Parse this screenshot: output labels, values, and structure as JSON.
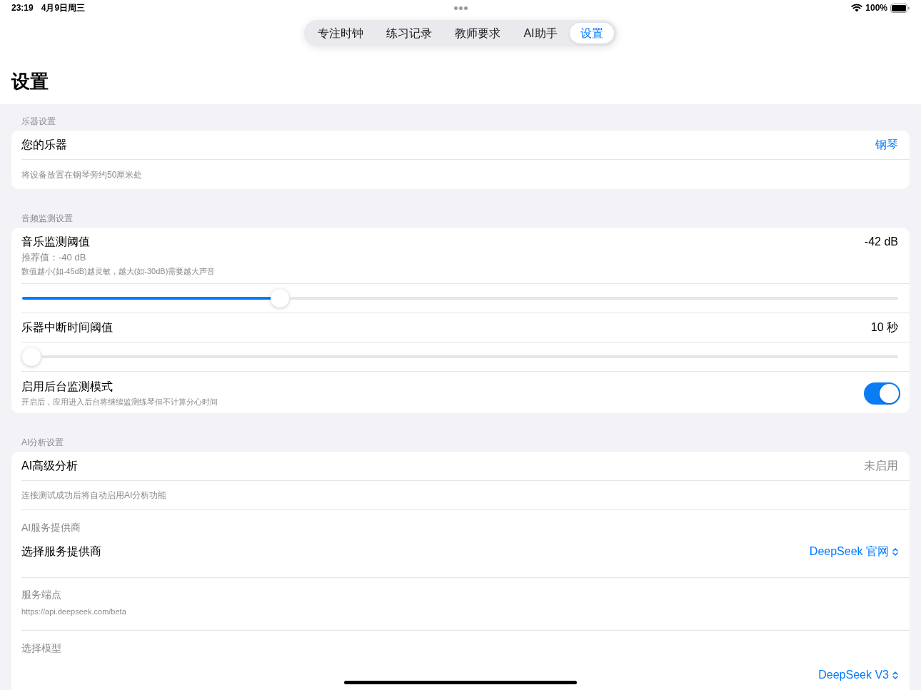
{
  "status_bar": {
    "time": "23:19",
    "date": "4月9日周三",
    "battery": "100%"
  },
  "tabs": [
    {
      "label": "专注时钟",
      "selected": false
    },
    {
      "label": "练习记录",
      "selected": false
    },
    {
      "label": "教师要求",
      "selected": false
    },
    {
      "label": "AI助手",
      "selected": false
    },
    {
      "label": "设置",
      "selected": true
    }
  ],
  "page_title": "设置",
  "sections": [
    {
      "header": "乐器设置",
      "rows": [
        {
          "kind": "value",
          "label": "您的乐器",
          "value": {
            "kind": "link",
            "text": "钢琴"
          }
        },
        {
          "kind": "note",
          "text": "将设备放置在钢琴旁约50厘米处"
        }
      ]
    },
    {
      "header": "音频监测设置",
      "rows": [
        {
          "kind": "value",
          "label": "音乐监测阈值",
          "hint": "推荐值：-40 dB",
          "note": "数值越小(如-45dB)越灵敏，越大(如-30dB)需要越大声音",
          "value": {
            "kind": "plain",
            "text": "-42 dB"
          }
        },
        {
          "kind": "slider",
          "level": 0.29
        },
        {
          "kind": "value",
          "label": "乐器中断时间阈值",
          "value": {
            "kind": "plain",
            "text": "10 秒"
          }
        },
        {
          "kind": "slider",
          "level": 0
        },
        {
          "kind": "toggle",
          "label": "启用后台监测模式",
          "note": "开启后，应用进入后台将继续监测练琴但不计算分心时间",
          "on": true
        }
      ]
    },
    {
      "header": "AI分析设置",
      "rows": [
        {
          "kind": "value",
          "label": "AI高级分析",
          "value": {
            "kind": "muted",
            "text": "未启用"
          }
        },
        {
          "kind": "note",
          "text": "连接测试成功后将自动启用AI分析功能"
        },
        {
          "kind": "picker",
          "caption": "AI服务提供商",
          "label": "选择服务提供商",
          "value": "DeepSeek 官网"
        },
        {
          "kind": "info",
          "caption": "服务端点",
          "text": "https://api.deepseek.com/beta"
        },
        {
          "kind": "picker",
          "caption": "选择模型",
          "value": "DeepSeek V3"
        }
      ]
    }
  ]
}
